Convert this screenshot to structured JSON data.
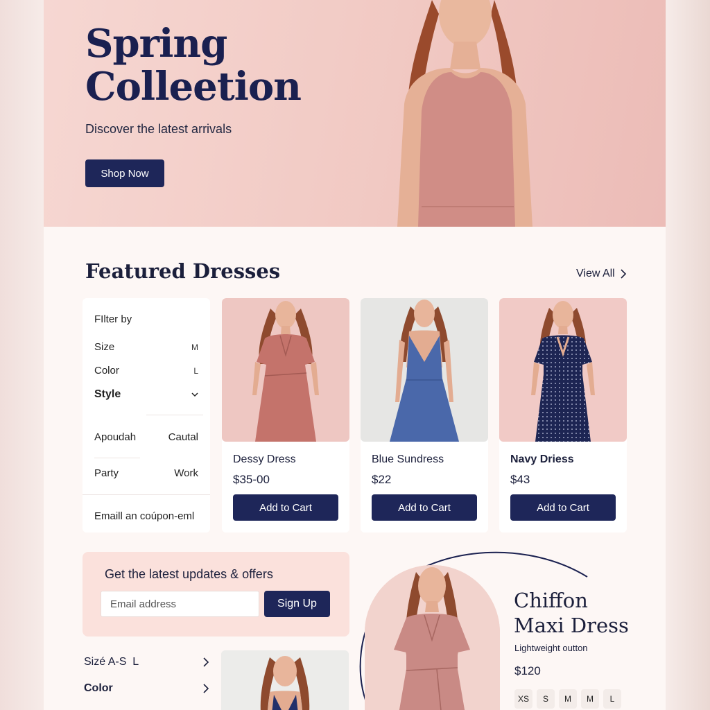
{
  "hero": {
    "title": "Spring Colleetion",
    "subtitle": "Discover the latest arrivals",
    "cta_label": "Shop Now"
  },
  "featured": {
    "title": "Featured Dresses",
    "view_all_label": "View All"
  },
  "filter": {
    "heading": "FIlter by",
    "size_label": "Size",
    "size_value": "M",
    "color_label": "Color",
    "color_value": "L",
    "style_label": "Style",
    "options": [
      [
        "Apoudah",
        "Cautal"
      ],
      [
        "Party",
        "Work"
      ]
    ],
    "coupon_text": "Emaill an coúpon-eml"
  },
  "products": [
    {
      "name": "Dessy Dress",
      "price": "$35-00",
      "cta": "Add to Cart",
      "color": "#c4736b",
      "bg": "#eec7c2"
    },
    {
      "name": "Blue Sundress",
      "price": "$22",
      "cta": "Add to Cart",
      "color": "#4a68aa",
      "bg": "#e6e6e4"
    },
    {
      "name": "Navy Driess",
      "price": "$43",
      "cta": "Add to Cart",
      "color": "#1d2553",
      "bg": "#f1cac6"
    }
  ],
  "newsletter": {
    "title": "Get the latest updates & offers",
    "email_placeholder": "Email address",
    "signup_label": "Sign Up"
  },
  "bottom_filters": [
    {
      "label": "Sizé A-S",
      "value": "L"
    },
    {
      "label": "Color",
      "value": ""
    }
  ],
  "promo": {
    "title_line1": "Chiffon",
    "title_line2": "Maxi Dress",
    "subtitle": "Lightweight outton",
    "price": "$120",
    "sizes": [
      "XS",
      "S",
      "M",
      "M",
      "L"
    ]
  },
  "colors": {
    "navy": "#1e2659",
    "blush": "#f1c9c3",
    "rose_dress": "#c98a85"
  }
}
